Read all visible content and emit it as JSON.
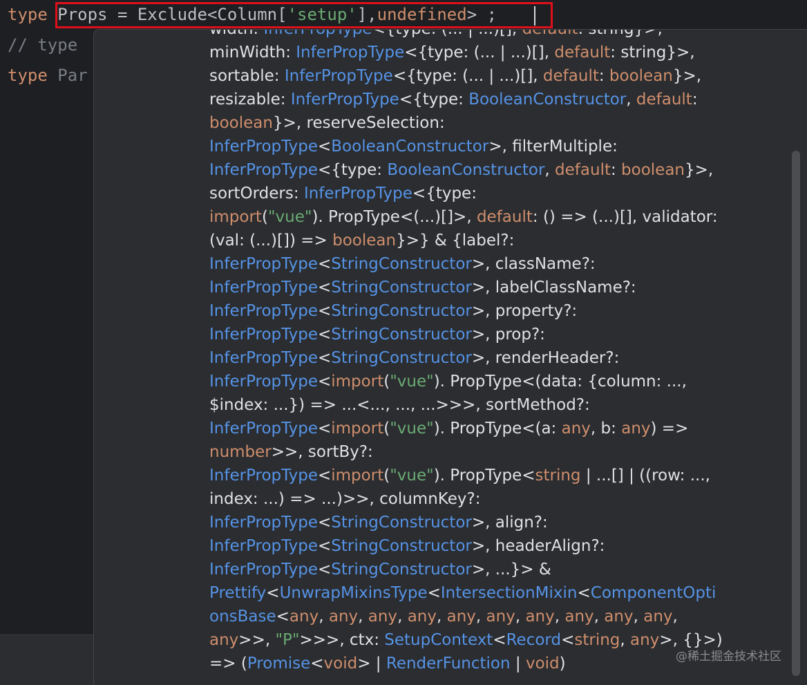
{
  "editor": {
    "line1": {
      "kw": "type",
      "name": " Props = Exclude<Column[",
      "str": "'setup'",
      "mid": "],",
      "kw2": "undefined",
      "end": "> ;"
    },
    "line2": {
      "comment": "// type"
    },
    "line3": {
      "kw": "type",
      "rest": " Par"
    }
  },
  "doc_lines": [
    [
      [
        "t",
        "width: "
      ],
      [
        "b",
        "InferPropType"
      ],
      [
        "t",
        "<{type: (... | ...)[], "
      ],
      [
        "o",
        "default"
      ],
      [
        "t",
        ": string}>,"
      ]
    ],
    [
      [
        "t",
        "minWidth: "
      ],
      [
        "b",
        "InferPropType"
      ],
      [
        "t",
        "<{type: (... | ...)[], "
      ],
      [
        "o",
        "default"
      ],
      [
        "t",
        ": string}>,"
      ]
    ],
    [
      [
        "t",
        "sortable: "
      ],
      [
        "b",
        "InferPropType"
      ],
      [
        "t",
        "<{type: (... | ...)[], "
      ],
      [
        "o",
        "default"
      ],
      [
        "t",
        ": "
      ],
      [
        "o",
        "boolean"
      ],
      [
        "t",
        "}>,"
      ]
    ],
    [
      [
        "t",
        "resizable: "
      ],
      [
        "b",
        "InferPropType"
      ],
      [
        "t",
        "<{type: "
      ],
      [
        "b",
        "BooleanConstructor"
      ],
      [
        "t",
        ", "
      ],
      [
        "o",
        "default"
      ],
      [
        "t",
        ":"
      ]
    ],
    [
      [
        "o",
        "boolean"
      ],
      [
        "t",
        "}>, reserveSelection:"
      ]
    ],
    [
      [
        "b",
        "InferPropType"
      ],
      [
        "t",
        "<"
      ],
      [
        "b",
        "BooleanConstructor"
      ],
      [
        "t",
        ">, filterMultiple:"
      ]
    ],
    [
      [
        "b",
        "InferPropType"
      ],
      [
        "t",
        "<{type: "
      ],
      [
        "b",
        "BooleanConstructor"
      ],
      [
        "t",
        ", "
      ],
      [
        "o",
        "default"
      ],
      [
        "t",
        ": "
      ],
      [
        "o",
        "boolean"
      ],
      [
        "t",
        "}>,"
      ]
    ],
    [
      [
        "t",
        "sortOrders: "
      ],
      [
        "b",
        "InferPropType"
      ],
      [
        "t",
        "<{type:"
      ]
    ],
    [
      [
        "o",
        "import"
      ],
      [
        "t",
        "("
      ],
      [
        "g",
        "\"vue\""
      ],
      [
        "t",
        "). PropType<(...)[]>, "
      ],
      [
        "o",
        "default"
      ],
      [
        "t",
        ": () => (...)[], validator:"
      ]
    ],
    [
      [
        "t",
        "(val: (...)[]) => "
      ],
      [
        "o",
        "boolean"
      ],
      [
        "t",
        "}>} & {label?:"
      ]
    ],
    [
      [
        "b",
        "InferPropType"
      ],
      [
        "t",
        "<"
      ],
      [
        "b",
        "StringConstructor"
      ],
      [
        "t",
        ">, className?:"
      ]
    ],
    [
      [
        "b",
        "InferPropType"
      ],
      [
        "t",
        "<"
      ],
      [
        "b",
        "StringConstructor"
      ],
      [
        "t",
        ">, labelClassName?:"
      ]
    ],
    [
      [
        "b",
        "InferPropType"
      ],
      [
        "t",
        "<"
      ],
      [
        "b",
        "StringConstructor"
      ],
      [
        "t",
        ">, property?:"
      ]
    ],
    [
      [
        "b",
        "InferPropType"
      ],
      [
        "t",
        "<"
      ],
      [
        "b",
        "StringConstructor"
      ],
      [
        "t",
        ">, prop?:"
      ]
    ],
    [
      [
        "b",
        "InferPropType"
      ],
      [
        "t",
        "<"
      ],
      [
        "b",
        "StringConstructor"
      ],
      [
        "t",
        ">, renderHeader?:"
      ]
    ],
    [
      [
        "b",
        "InferPropType"
      ],
      [
        "t",
        "<"
      ],
      [
        "o",
        "import"
      ],
      [
        "t",
        "("
      ],
      [
        "g",
        "\"vue\""
      ],
      [
        "t",
        "). PropType<(data: {column: ...,"
      ]
    ],
    [
      [
        "t",
        "$index: ...}) => ...<..., ..., ...>>>, sortMethod?:"
      ]
    ],
    [
      [
        "b",
        "InferPropType"
      ],
      [
        "t",
        "<"
      ],
      [
        "o",
        "import"
      ],
      [
        "t",
        "("
      ],
      [
        "g",
        "\"vue\""
      ],
      [
        "t",
        "). PropType<(a: "
      ],
      [
        "o",
        "any"
      ],
      [
        "t",
        ", b: "
      ],
      [
        "o",
        "any"
      ],
      [
        "t",
        ") =>"
      ]
    ],
    [
      [
        "o",
        "number"
      ],
      [
        "t",
        ">>, sortBy?:"
      ]
    ],
    [
      [
        "b",
        "InferPropType"
      ],
      [
        "t",
        "<"
      ],
      [
        "o",
        "import"
      ],
      [
        "t",
        "("
      ],
      [
        "g",
        "\"vue\""
      ],
      [
        "t",
        "). PropType<"
      ],
      [
        "o",
        "string"
      ],
      [
        "t",
        " | ...[] | ((row: ...,"
      ]
    ],
    [
      [
        "t",
        "index: ...) => ...)>>, columnKey?:"
      ]
    ],
    [
      [
        "b",
        "InferPropType"
      ],
      [
        "t",
        "<"
      ],
      [
        "b",
        "StringConstructor"
      ],
      [
        "t",
        ">, align?:"
      ]
    ],
    [
      [
        "b",
        "InferPropType"
      ],
      [
        "t",
        "<"
      ],
      [
        "b",
        "StringConstructor"
      ],
      [
        "t",
        ">, headerAlign?:"
      ]
    ],
    [
      [
        "b",
        "InferPropType"
      ],
      [
        "t",
        "<"
      ],
      [
        "b",
        "StringConstructor"
      ],
      [
        "t",
        ">, ...}> &"
      ]
    ],
    [
      [
        "b",
        "Prettify"
      ],
      [
        "t",
        "<"
      ],
      [
        "b",
        "UnwrapMixinsType"
      ],
      [
        "t",
        "<"
      ],
      [
        "b",
        "IntersectionMixin"
      ],
      [
        "t",
        "<"
      ],
      [
        "b",
        "ComponentOpti"
      ]
    ],
    [
      [
        "b",
        "onsBase"
      ],
      [
        "t",
        "<"
      ],
      [
        "o",
        "any"
      ],
      [
        "t",
        ", "
      ],
      [
        "o",
        "any"
      ],
      [
        "t",
        ", "
      ],
      [
        "o",
        "any"
      ],
      [
        "t",
        ", "
      ],
      [
        "o",
        "any"
      ],
      [
        "t",
        ", "
      ],
      [
        "o",
        "any"
      ],
      [
        "t",
        ", "
      ],
      [
        "o",
        "any"
      ],
      [
        "t",
        ", "
      ],
      [
        "o",
        "any"
      ],
      [
        "t",
        ", "
      ],
      [
        "o",
        "any"
      ],
      [
        "t",
        ", "
      ],
      [
        "o",
        "any"
      ],
      [
        "t",
        ", "
      ],
      [
        "o",
        "any"
      ],
      [
        "t",
        ","
      ]
    ],
    [
      [
        "o",
        "any"
      ],
      [
        "t",
        ">>, "
      ],
      [
        "g",
        "\"P\""
      ],
      [
        "t",
        ">>>, ctx: "
      ],
      [
        "b",
        "SetupContext"
      ],
      [
        "t",
        "<"
      ],
      [
        "b",
        "Record"
      ],
      [
        "t",
        "<"
      ],
      [
        "o",
        "string"
      ],
      [
        "t",
        ", "
      ],
      [
        "o",
        "any"
      ],
      [
        "t",
        ">, {}>)"
      ]
    ],
    [
      [
        "t",
        "=> ("
      ],
      [
        "b",
        "Promise"
      ],
      [
        "t",
        "<"
      ],
      [
        "o",
        "void"
      ],
      [
        "t",
        "> | "
      ],
      [
        "b",
        "RenderFunction"
      ],
      [
        "t",
        " | "
      ],
      [
        "o",
        "void"
      ],
      [
        "t",
        ")"
      ]
    ]
  ],
  "watermark": "@稀土掘金技术社区",
  "colors": {
    "bg": "#1e1f22",
    "popup_bg": "#2b2d30",
    "type_ref": "#5693e6",
    "keyword": "#cf8e6d",
    "string": "#6aab73",
    "highlight_border": "#e0101a"
  }
}
